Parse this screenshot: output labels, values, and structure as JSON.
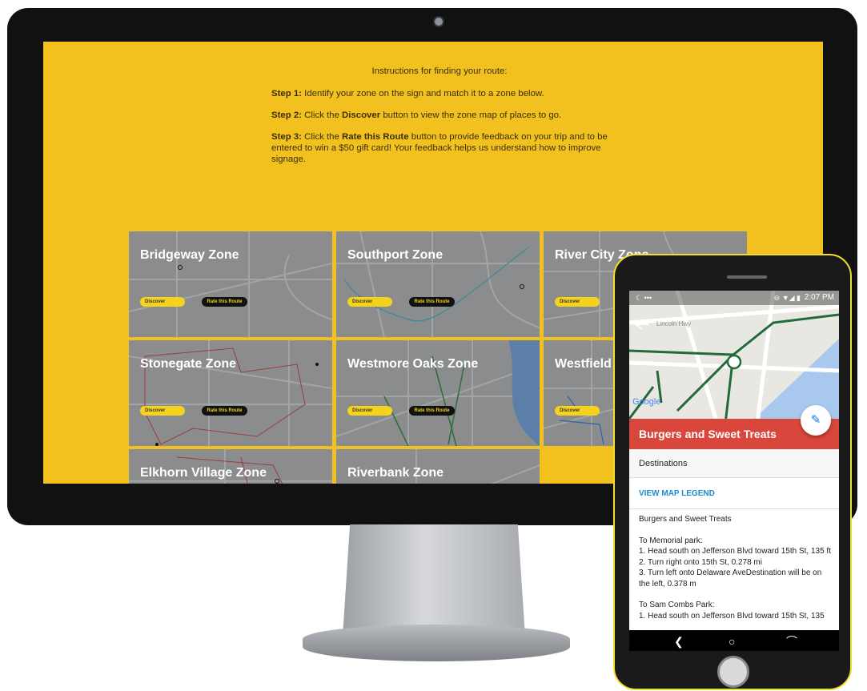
{
  "instructions": {
    "title": "Instructions for finding your route:",
    "step1_label": "Step 1:",
    "step1_text": "Identify your zone on the sign and match it to a zone below.",
    "step2_label": "Step 2:",
    "step2_pre": "Click the",
    "step2_bold": "Discover",
    "step2_post": "button to view the zone map of places to go.",
    "step3_label": "Step 3:",
    "step3_pre": "Click the",
    "step3_bold": "Rate this Route",
    "step3_post": "button to provide feedback on your trip and to be entered to win a $50 gift card! Your feedback helps us understand how to improve signage."
  },
  "zones": [
    {
      "name": "Bridgeway Zone",
      "discover": "Discover",
      "rate": "Rate this Route"
    },
    {
      "name": "Southport Zone",
      "discover": "Discover",
      "rate": "Rate this Route"
    },
    {
      "name": "River City Zone",
      "discover": "Discover",
      "rate": ""
    },
    {
      "name": "Stonegate Zone",
      "discover": "Discover",
      "rate": "Rate this Route"
    },
    {
      "name": "Westmore Oaks Zone",
      "discover": "Discover",
      "rate": "Rate this Route"
    },
    {
      "name": "Westfield Zone",
      "discover": "Discover",
      "rate": ""
    },
    {
      "name": "Elkhorn Village Zone",
      "discover": "",
      "rate": ""
    },
    {
      "name": "Riverbank Zone",
      "discover": "",
      "rate": ""
    }
  ],
  "phone": {
    "status_time": "2:07 PM",
    "status_left": "☾ •••",
    "status_icons": "⊖ ▼◢ ▮",
    "map_label_google": "Google",
    "map_label_road": "Lincoln Hwy",
    "fab_icon": "edit-icon",
    "header_title": "Burgers and Sweet Treats",
    "destinations_label": "Destinations",
    "legend_link": "VIEW MAP LEGEND",
    "section_title": "Burgers and Sweet Treats",
    "route1_title": "To Memorial park:",
    "route1_steps": [
      "1. Head south on Jefferson Blvd toward 15th St, 135 ft",
      "2. Turn right onto 15th St, 0.278 mi",
      "3. Turn left onto Delaware AveDestination will be on the left, 0.378 m"
    ],
    "route2_title": "To Sam Combs Park:",
    "route2_step": "1. Head south on Jefferson Blvd toward 15th St, 135",
    "nav_back": "❮",
    "nav_home": "○",
    "nav_recent": "⌒"
  },
  "colors": {
    "screen_bg": "#f2c11f",
    "discover_button": "#f5d21c",
    "rate_button": "#111111",
    "phone_header": "#d9463b",
    "legend_link": "#1a8ad2"
  }
}
